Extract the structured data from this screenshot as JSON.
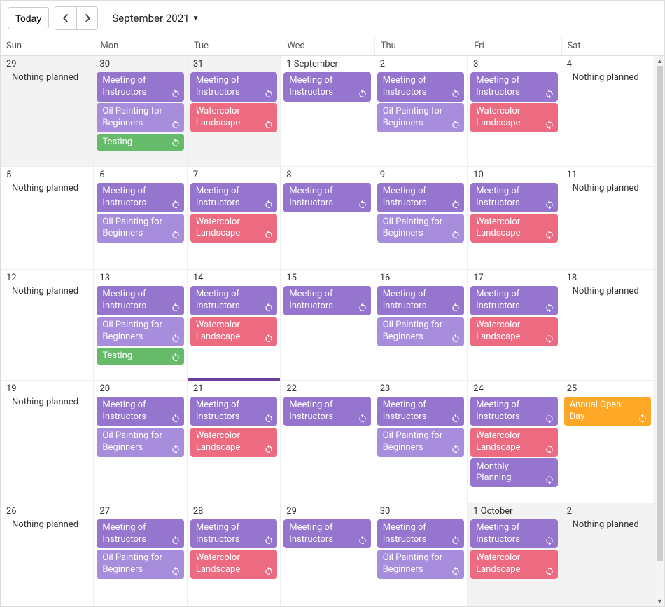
{
  "toolbar": {
    "today_label": "Today",
    "month_label": "September 2021"
  },
  "day_headers": [
    "Sun",
    "Mon",
    "Tue",
    "Wed",
    "Thu",
    "Fri",
    "Sat"
  ],
  "nothing_text": "Nothing planned",
  "colors": {
    "meeting": "#9575cd",
    "oil": "#a78ddb",
    "water": "#ec6b81",
    "testing": "#66bb6a",
    "planning": "#9575cd",
    "openday": "#ffa726"
  },
  "event_labels": {
    "meeting": "Meeting of Instructors",
    "oil": "Oil Painting for Beginners",
    "water": "Watercolor Landscape",
    "testing": "Testing",
    "planning": "Monthly Planning",
    "openday": "Annual Open Day"
  },
  "weeks": [
    [
      {
        "date": "29",
        "out": true,
        "events": [],
        "nothing": true
      },
      {
        "date": "30",
        "out": true,
        "events": [
          "meeting",
          "oil",
          "testing"
        ]
      },
      {
        "date": "31",
        "out": true,
        "events": [
          "meeting",
          "water"
        ]
      },
      {
        "date": "1 September",
        "events": [
          "meeting"
        ]
      },
      {
        "date": "2",
        "events": [
          "meeting",
          "oil"
        ]
      },
      {
        "date": "3",
        "events": [
          "meeting",
          "water"
        ]
      },
      {
        "date": "4",
        "events": [],
        "nothing": true
      }
    ],
    [
      {
        "date": "5",
        "events": [],
        "nothing": true
      },
      {
        "date": "6",
        "events": [
          "meeting",
          "oil"
        ]
      },
      {
        "date": "7",
        "events": [
          "meeting",
          "water"
        ]
      },
      {
        "date": "8",
        "events": [
          "meeting"
        ]
      },
      {
        "date": "9",
        "events": [
          "meeting",
          "oil"
        ]
      },
      {
        "date": "10",
        "events": [
          "meeting",
          "water"
        ]
      },
      {
        "date": "11",
        "events": [],
        "nothing": true
      }
    ],
    [
      {
        "date": "12",
        "events": [],
        "nothing": true
      },
      {
        "date": "13",
        "events": [
          "meeting",
          "oil",
          "testing"
        ]
      },
      {
        "date": "14",
        "events": [
          "meeting",
          "water"
        ],
        "today": true
      },
      {
        "date": "15",
        "events": [
          "meeting"
        ]
      },
      {
        "date": "16",
        "events": [
          "meeting",
          "oil"
        ]
      },
      {
        "date": "17",
        "events": [
          "meeting",
          "water"
        ]
      },
      {
        "date": "18",
        "events": [],
        "nothing": true
      }
    ],
    [
      {
        "date": "19",
        "events": [],
        "nothing": true
      },
      {
        "date": "20",
        "events": [
          "meeting",
          "oil"
        ]
      },
      {
        "date": "21",
        "events": [
          "meeting",
          "water"
        ]
      },
      {
        "date": "22",
        "events": [
          "meeting"
        ]
      },
      {
        "date": "23",
        "events": [
          "meeting",
          "oil"
        ]
      },
      {
        "date": "24",
        "events": [
          "meeting",
          "water",
          "planning"
        ]
      },
      {
        "date": "25",
        "events": [
          "openday"
        ]
      }
    ],
    [
      {
        "date": "26",
        "events": [],
        "nothing": true
      },
      {
        "date": "27",
        "events": [
          "meeting",
          "oil"
        ]
      },
      {
        "date": "28",
        "events": [
          "meeting",
          "water"
        ]
      },
      {
        "date": "29",
        "events": [
          "meeting"
        ]
      },
      {
        "date": "30",
        "events": [
          "meeting",
          "oil"
        ]
      },
      {
        "date": "1 October",
        "out": true,
        "events": [
          "meeting",
          "water"
        ]
      },
      {
        "date": "2",
        "out": true,
        "events": [],
        "nothing": true
      }
    ]
  ]
}
